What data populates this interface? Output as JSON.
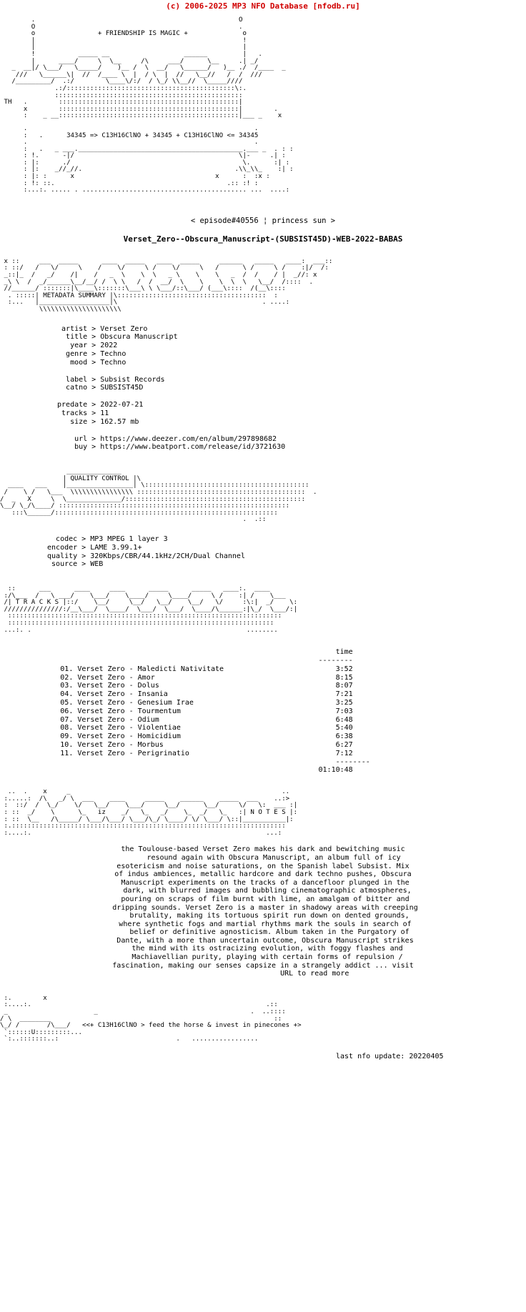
{
  "site": {
    "copyright_banner": "(c) 2006-2025 MP3 NFO Database [nfodb.ru]",
    "banner_color": "#d00000"
  },
  "art": {
    "tagline": "+ FRIENDSHIP IS MAGIC +",
    "formula_line": "34345 => C13H16ClNO + 34345 + C13H16ClNO <= 34345",
    "header_art": "        .                                                    O\n        O                                                    .\n        o                + FRIENDSHIP IS MAGIC +              o\n        |                                                     !\n        |                                                     |\n        !           _____ __                   ______         |   .\n        |      ____/     \\  \\__     /\\     ___/      \\__     .| _/\n   _  __|/ \\___/   \\_____/    )__ /  \\  __/   \\______/   )__ ./  /____  _\n    ///   \\______\\|  //  /____ \\  |  / \\  |  //   \\__//   /  /  ///\n   /_________/  .:/        \\____\\/:/  / \\_/ \\\\__//  \\_____//// \n              .:/:::::::::::::::::::::::::::::::::::::::::::\\:.\n              ::::::::::::::::::::::::::::::::::::::::::::::::\n TH   .        ::::::::::::::::::::::::::::::::::::::::::::::|\n      x        ::::::::::::::::::::::::::::::::::::::::::::::|        .\n      :    _ __::::::::::::::::::::::::::::::::::::::::::::::|___ _    x",
    "mid_art": "      .                                                          .\n      :   .      34345 => C13H16ClNO + 34345 + C13H16ClNO <= 34345\n      .                                                          .\n      :   .   _ ___.__________________________________________.___ _  . : :\n      : !.      -|/                                          \\|-     .| :\n      : |:      ./                                            \\.      :| :\n      : |:    _//_//.                                       .\\\\_\\\\_    :| :\n      : |: :      x                                    x      :  :x :\n      : !: ::.                                            .:: :! :\n      :...:. ..... . .......................................... ...  ....:"
  },
  "release": {
    "episode_line": "< episode#40556 ¦ princess sun >",
    "dirname": "Verset_Zero--Obscura_Manuscript-(SUBSIST45D)-WEB-2022-BABAS"
  },
  "metadata_section": {
    "banner_label": "METADATA SUMMARY",
    "fields": [
      {
        "key": "artist",
        "sep": ">",
        "value": "Verset Zero"
      },
      {
        "key": "title",
        "sep": ">",
        "value": "Obscura Manuscript"
      },
      {
        "key": "year",
        "sep": ">",
        "value": "2022"
      },
      {
        "key": "genre",
        "sep": ">",
        "value": "Techno"
      },
      {
        "key": "mood",
        "sep": ">",
        "value": "Techno"
      }
    ],
    "fields2": [
      {
        "key": "label",
        "sep": ">",
        "value": "Subsist Records"
      },
      {
        "key": "catno",
        "sep": ">",
        "value": "SUBSIST45D"
      }
    ],
    "fields3": [
      {
        "key": "predate",
        "sep": ">",
        "value": "2022-07-21"
      },
      {
        "key": "tracks",
        "sep": ">",
        "value": "11"
      },
      {
        "key": "size",
        "sep": ">",
        "value": "162.57 mb"
      }
    ],
    "links": [
      {
        "key": "url",
        "sep": ">",
        "value": "https://www.deezer.com/en/album/297898682"
      },
      {
        "key": "buy",
        "sep": ">",
        "value": "https://www.beatport.com/release/id/3721630"
      }
    ],
    "block1": "  artist > Verset Zero\n   title > Obscura Manuscript\n    year > 2022\n   genre > Techno\n    mood > Techno",
    "block2": "   label > Subsist Records\n   catno > SUBSIST45D",
    "block3": " predate > 2022-07-21\n  tracks > 11\n    size > 162.57 mb",
    "block4": "     url > https://www.deezer.com/en/album/297898682\n     buy > https://www.beatport.com/release/id/3721630"
  },
  "quality_section": {
    "banner_label": "QUALITY CONTROL",
    "fields": [
      {
        "key": "codec",
        "sep": ">",
        "value": "MP3 MPEG 1 layer 3"
      },
      {
        "key": "encoder",
        "sep": ">",
        "value": "LAME 3.99.1+"
      },
      {
        "key": "quality",
        "sep": ">",
        "value": "320Kbps/CBR/44.1kHz/2CH/Dual Channel"
      },
      {
        "key": "source",
        "sep": ">",
        "value": "WEB"
      }
    ],
    "block": "   codec > MP3 MPEG 1 layer 3\n encoder > LAME 3.99.1+\n quality > 320Kbps/CBR/44.1kHz/2CH/Dual Channel\n  source > WEB"
  },
  "tracks_section": {
    "banner_label": "T R A C K S",
    "time_header": "time",
    "time_rule": "--------",
    "total_rule": "--------",
    "total_time": "01:10:48",
    "rows": [
      {
        "num": "01.",
        "artist": "Verset Zero",
        "dash": "-",
        "title": "Maledicti Nativitate",
        "time": "3:52"
      },
      {
        "num": "02.",
        "artist": "Verset Zero",
        "dash": "-",
        "title": "Amor",
        "time": "8:15"
      },
      {
        "num": "03.",
        "artist": "Verset Zero",
        "dash": "-",
        "title": "Dolus",
        "time": "8:07"
      },
      {
        "num": "04.",
        "artist": "Verset Zero",
        "dash": "-",
        "title": "Insania",
        "time": "7:21"
      },
      {
        "num": "05.",
        "artist": "Verset Zero",
        "dash": "-",
        "title": "Genesium Irae",
        "time": "3:25"
      },
      {
        "num": "06.",
        "artist": "Verset Zero",
        "dash": "-",
        "title": "Tourmentum",
        "time": "7:03"
      },
      {
        "num": "07.",
        "artist": "Verset Zero",
        "dash": "-",
        "title": "Odium",
        "time": "6:48"
      },
      {
        "num": "08.",
        "artist": "Verset Zero",
        "dash": "-",
        "title": "Violentiae",
        "time": "5:40"
      },
      {
        "num": "09.",
        "artist": "Verset Zero",
        "dash": "-",
        "title": "Homicidium",
        "time": "6:38"
      },
      {
        "num": "10.",
        "artist": "Verset Zero",
        "dash": "-",
        "title": "Morbus",
        "time": "6:27"
      },
      {
        "num": "11.",
        "artist": "Verset Zero",
        "dash": "-",
        "title": "Perigrinatio",
        "time": "7:12"
      }
    ]
  },
  "notes_section": {
    "banner_label": "N O T E S",
    "body": "the Toulouse-based Verset Zero makes his dark and bewitching music\n     resound again with Obscura Manuscript, an album full of icy\nesotericism and noise saturations, on the Spanish label Subsist. Mix\nof indus ambiences, metallic hardcore and dark techno pushes, Obscura\n Manuscript experiments on the tracks of a dancefloor plunged in the\n  dark, with blurred images and bubbling cinematographic atmospheres,\n pouring on scraps of film burnt with lime, an amalgam of bitter and\n dripping sounds. Verset Zero is a master in shadowy areas with creeping\n   brutality, making its tortuous spirit run down on dented grounds,\n where synthetic fogs and martial rhythms mark the souls in search of\n   belief or definitive agnosticism. Album taken in the Purgatory of\n Dante, with a more than uncertain outcome, Obscura Manuscript strikes\n  the mind with its ostracizing evolution, with foggy flashes and\n  Machiavellian purity, playing with certain forms of repulsion /\nfascination, making our senses capsize in a strangely addict ... visit\n                        URL to read more"
  },
  "footer_section": {
    "greet_line": "<<+ C13H16ClNO > feed the horse & invest in pinecones +>",
    "last_update_label": "last nfo update:",
    "last_update_value": "20220405",
    "last_update_line": "last nfo update: 20220405"
  }
}
